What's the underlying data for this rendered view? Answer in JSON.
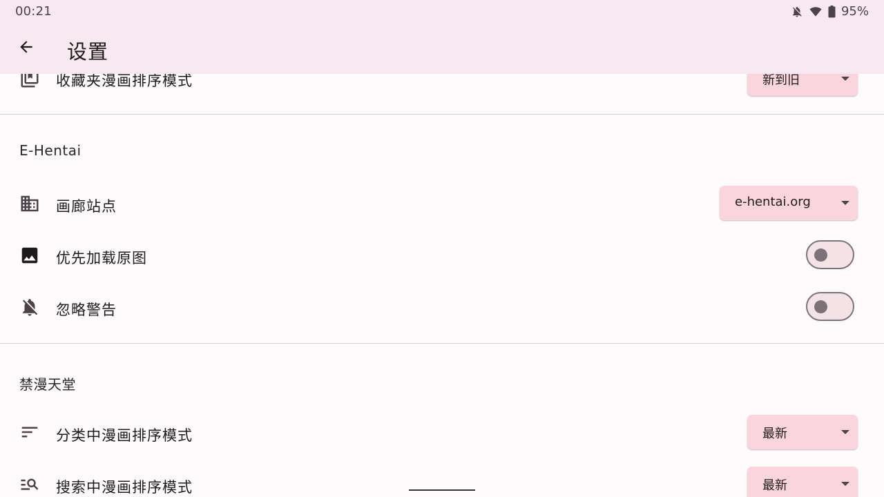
{
  "status_bar": {
    "time": "00:21",
    "battery": "95%",
    "icons": [
      "notifications-off-icon",
      "wifi-icon",
      "battery-icon"
    ]
  },
  "app_bar": {
    "title": "设置",
    "back_icon": "arrow-back-icon"
  },
  "partial_row": {
    "label": "收藏夹漫画排序模式",
    "icon": "bookmarks-icon",
    "value": "新到旧"
  },
  "ehentai": {
    "section_title": "E-Hentai",
    "gallery_site": {
      "label": "画廊站点",
      "icon": "apartment-icon",
      "value": "e-hentai.org"
    },
    "load_original": {
      "label": "优先加载原图",
      "icon": "image-icon",
      "enabled": false
    },
    "ignore_warning": {
      "label": "忽略警告",
      "icon": "notifications-off-icon",
      "enabled": false
    }
  },
  "jm": {
    "section_title": "禁漫天堂",
    "category_sort": {
      "label": "分类中漫画排序模式",
      "icon": "sort-icon",
      "value": "最新"
    },
    "search_sort": {
      "label": "搜索中漫画排序模式",
      "icon": "manage-search-icon",
      "value": "最新"
    }
  },
  "colors": {
    "app_bar_bg": "#f8e8ef",
    "page_bg": "#fffbfd",
    "dropdown_bg": "#fbd5de",
    "switch_outline": "#7d7277"
  }
}
